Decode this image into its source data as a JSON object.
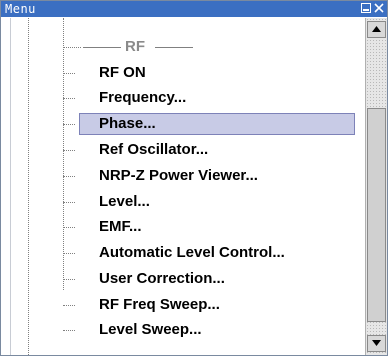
{
  "window": {
    "title": "Menu"
  },
  "tree": {
    "section_label": "RF",
    "items": [
      {
        "label": "RF ON"
      },
      {
        "label": "Frequency..."
      },
      {
        "label": "Phase...",
        "selected": true
      },
      {
        "label": "Ref Oscillator..."
      },
      {
        "label": "NRP-Z Power Viewer..."
      },
      {
        "label": "Level..."
      },
      {
        "label": "EMF..."
      },
      {
        "label": "Automatic Level Control..."
      },
      {
        "label": "User Correction..."
      },
      {
        "label": "RF Freq Sweep..."
      },
      {
        "label": "Level Sweep..."
      }
    ]
  },
  "icons": {
    "minimize": "minimize-icon",
    "close": "close-icon",
    "scroll_up": "arrow-up-icon",
    "scroll_down": "arrow-down-icon"
  },
  "colors": {
    "titlebar": "#3b6fc2",
    "selection": "#c8cbe6"
  }
}
